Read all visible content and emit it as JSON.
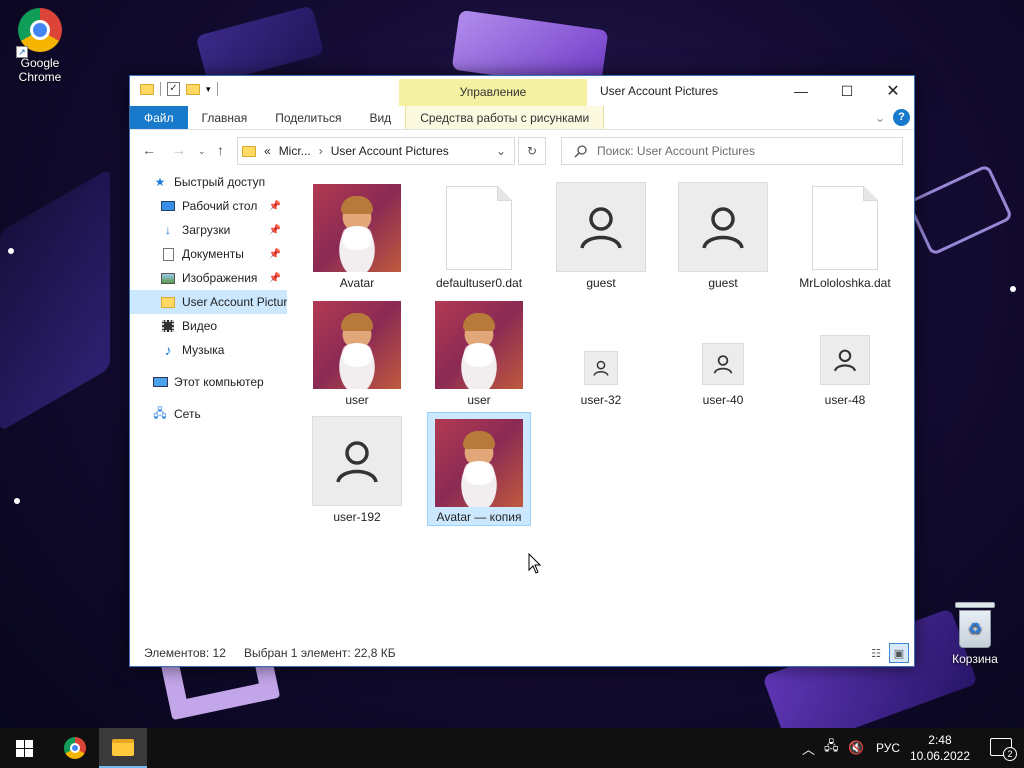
{
  "desktop": {
    "icons": [
      {
        "label": "Google Chrome"
      },
      {
        "label": "Корзина"
      }
    ]
  },
  "window": {
    "title": "User Account Pictures",
    "contextual_tab": "Управление",
    "ribbon_tabs": [
      "Файл",
      "Главная",
      "Поделиться",
      "Вид",
      "Средства работы с рисунками"
    ],
    "address": {
      "prefix": "«",
      "segments": [
        "Micr...",
        "User Account Pictures"
      ]
    },
    "search": {
      "placeholder": "Поиск: User Account Pictures"
    },
    "sidebar": {
      "items": [
        {
          "label": "Быстрый доступ",
          "icon": "star-icon",
          "pinned": false
        },
        {
          "label": "Рабочий стол",
          "icon": "desktop-icon",
          "pinned": true
        },
        {
          "label": "Загрузки",
          "icon": "download-icon",
          "pinned": true
        },
        {
          "label": "Документы",
          "icon": "documents-icon",
          "pinned": true
        },
        {
          "label": "Изображения",
          "icon": "pictures-icon",
          "pinned": true
        },
        {
          "label": "User Account Pictures",
          "icon": "folder-icon",
          "pinned": false
        },
        {
          "label": "Видео",
          "icon": "video-icon",
          "pinned": false
        },
        {
          "label": "Музыка",
          "icon": "music-icon",
          "pinned": false
        },
        {
          "label": "Этот компьютер",
          "icon": "computer-icon",
          "pinned": false
        },
        {
          "label": "Сеть",
          "icon": "network-icon",
          "pinned": false
        }
      ]
    },
    "files": [
      {
        "name": "Avatar",
        "type": "photo"
      },
      {
        "name": "defaultuser0.dat",
        "type": "document"
      },
      {
        "name": "guest",
        "type": "user-large"
      },
      {
        "name": "guest",
        "type": "user-large"
      },
      {
        "name": "MrLololoshka.dat",
        "type": "document"
      },
      {
        "name": "user",
        "type": "photo"
      },
      {
        "name": "user",
        "type": "photo"
      },
      {
        "name": "user-32",
        "type": "user-small"
      },
      {
        "name": "user-40",
        "type": "user-small"
      },
      {
        "name": "user-48",
        "type": "user-medium"
      },
      {
        "name": "user-192",
        "type": "user-large"
      },
      {
        "name": "Avatar — копия",
        "type": "photo",
        "selected": true
      }
    ],
    "status": {
      "count": "Элементов: 12",
      "selection": "Выбран 1 элемент: 22,8 КБ"
    }
  },
  "taskbar": {
    "language": "РУС",
    "time": "2:48",
    "date": "10.06.2022",
    "notifications": "2"
  },
  "colors": {
    "accent": "#1979ca",
    "selection": "#cce8ff",
    "contextual_tab": "#f5f1a3"
  }
}
